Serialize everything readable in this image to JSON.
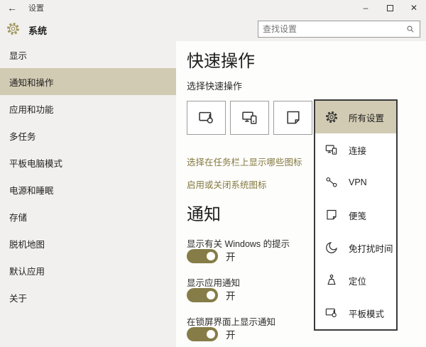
{
  "titlebar": {
    "title": "设置",
    "icons": {
      "back": "←",
      "minimize": "–",
      "close": "✕"
    }
  },
  "header": {
    "page_title": "系统",
    "search": {
      "placeholder": "查找设置"
    }
  },
  "sidebar": {
    "items": [
      {
        "label": "显示",
        "selected": false
      },
      {
        "label": "通知和操作",
        "selected": true
      },
      {
        "label": "应用和功能",
        "selected": false
      },
      {
        "label": "多任务",
        "selected": false
      },
      {
        "label": "平板电脑模式",
        "selected": false
      },
      {
        "label": "电源和睡眠",
        "selected": false
      },
      {
        "label": "存储",
        "selected": false
      },
      {
        "label": "脱机地图",
        "selected": false
      },
      {
        "label": "默认应用",
        "selected": false
      },
      {
        "label": "关于",
        "selected": false
      }
    ]
  },
  "main": {
    "quick_actions": {
      "title": "快速操作",
      "subtitle": "选择快速操作",
      "buttons": [
        {
          "icon": "tablet-mode-icon"
        },
        {
          "icon": "connect-icon"
        },
        {
          "icon": "note-icon"
        }
      ],
      "links": [
        {
          "label": "选择在任务栏上显示哪些图标"
        },
        {
          "label": "启用或关闭系统图标"
        }
      ]
    },
    "notifications": {
      "title": "通知",
      "toggles": [
        {
          "label": "显示有关 Windows 的提示",
          "state": "开",
          "on": true
        },
        {
          "label": "显示应用通知",
          "state": "开",
          "on": true
        },
        {
          "label": "在锁屏界面上显示通知",
          "state": "开",
          "on": true
        }
      ]
    }
  },
  "flyout": {
    "items": [
      {
        "label": "所有设置",
        "icon": "gear-icon",
        "selected": true
      },
      {
        "label": "连接",
        "icon": "connect-icon",
        "selected": false
      },
      {
        "label": "VPN",
        "icon": "vpn-icon",
        "selected": false
      },
      {
        "label": "便笺",
        "icon": "note-icon",
        "selected": false
      },
      {
        "label": "免打扰时间",
        "icon": "moon-icon",
        "selected": false
      },
      {
        "label": "定位",
        "icon": "location-icon",
        "selected": false
      },
      {
        "label": "平板模式",
        "icon": "tablet-mode-icon",
        "selected": false
      }
    ]
  },
  "colors": {
    "accent": "#857c47",
    "selection_beige": "#d2cbb3",
    "link_olive": "#84793f",
    "gear_gold": "#9b9155"
  }
}
